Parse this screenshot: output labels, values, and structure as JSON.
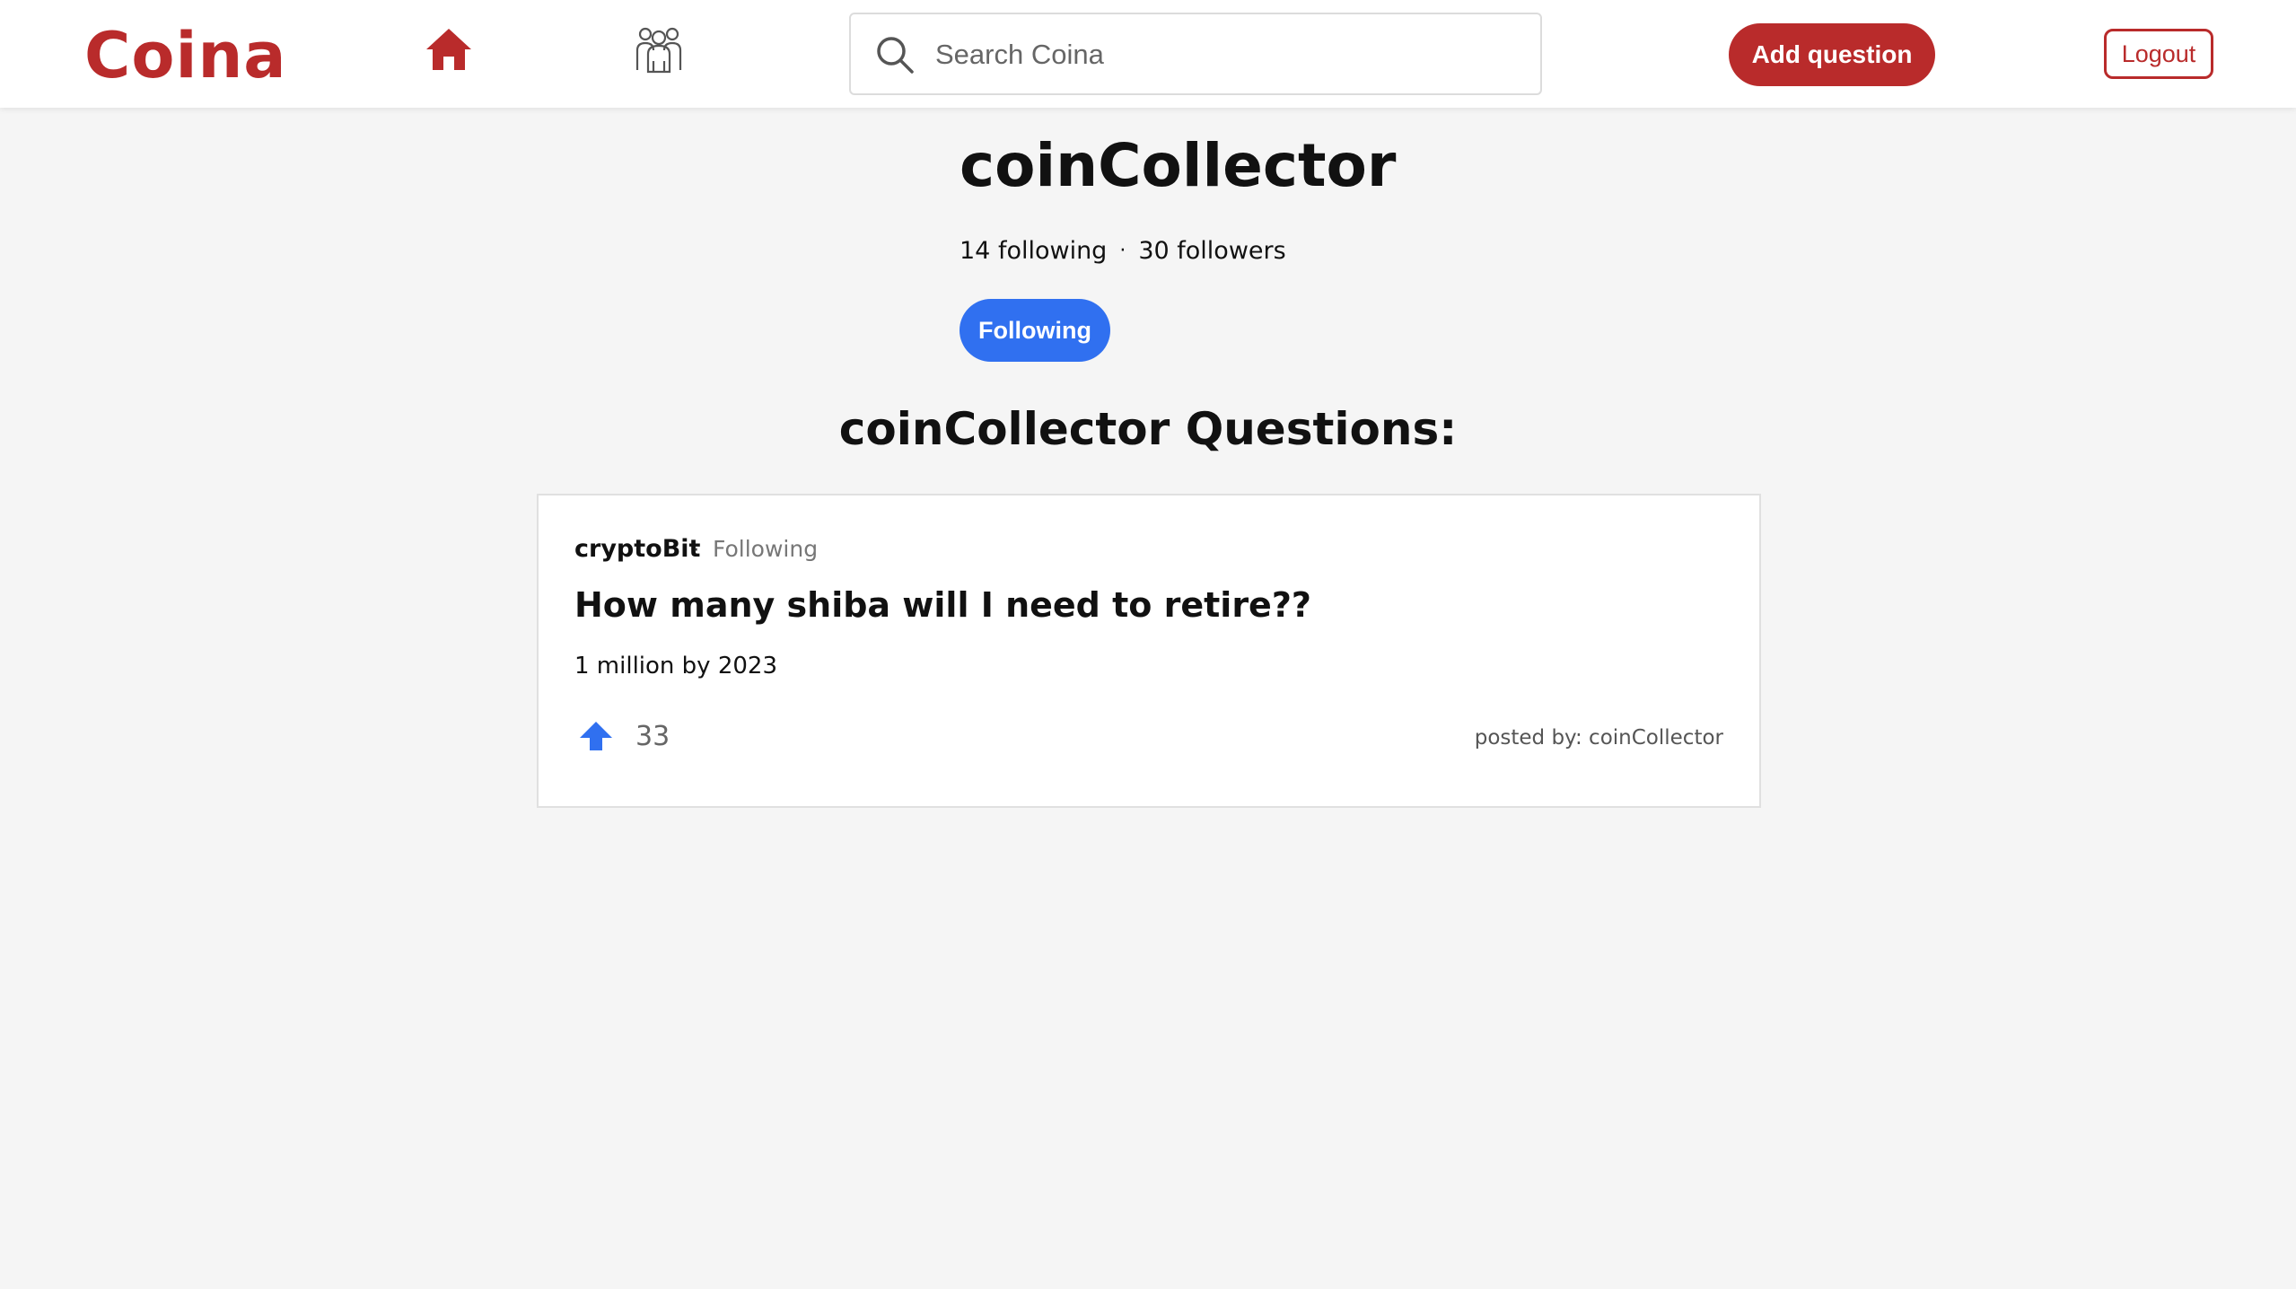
{
  "app": {
    "logo": "Coina",
    "brand_color": "#b92b2b",
    "accent_color": "#3070f0"
  },
  "header": {
    "nav": [
      {
        "name": "home",
        "icon": "home-icon"
      },
      {
        "name": "people",
        "icon": "people-icon"
      }
    ],
    "search": {
      "placeholder": "Search Coina",
      "value": ""
    },
    "add_question_label": "Add question",
    "logout_label": "Logout"
  },
  "profile": {
    "username": "coinCollector",
    "following_count": "14 following",
    "separator": "·",
    "followers_count": "30 followers",
    "follow_button_label": "Following"
  },
  "questions_section": {
    "title": "coinCollector Questions:",
    "items": [
      {
        "author": "cryptoBit",
        "separator": "·",
        "follow_status": "Following",
        "title": "How many shiba will I need to retire??",
        "body": "1 million by 2023",
        "votes": "33",
        "posted_by": "posted by: coinCollector"
      }
    ]
  }
}
